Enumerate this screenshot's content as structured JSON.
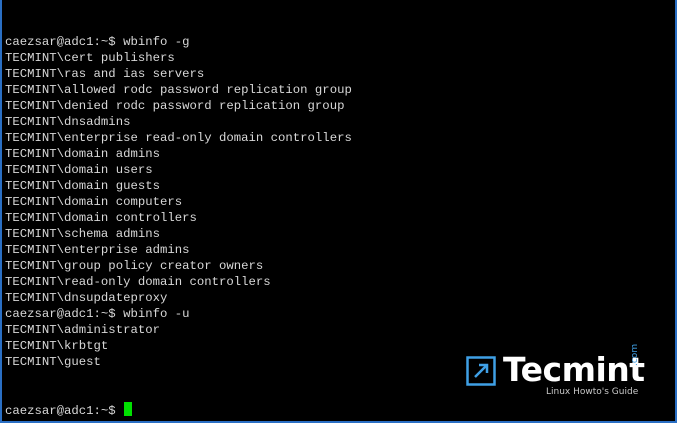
{
  "terminal": {
    "lines": [
      "caezsar@adc1:~$ wbinfo -g",
      "TECMINT\\cert publishers",
      "TECMINT\\ras and ias servers",
      "TECMINT\\allowed rodc password replication group",
      "TECMINT\\denied rodc password replication group",
      "TECMINT\\dnsadmins",
      "TECMINT\\enterprise read-only domain controllers",
      "TECMINT\\domain admins",
      "TECMINT\\domain users",
      "TECMINT\\domain guests",
      "TECMINT\\domain computers",
      "TECMINT\\domain controllers",
      "TECMINT\\schema admins",
      "TECMINT\\enterprise admins",
      "TECMINT\\group policy creator owners",
      "TECMINT\\read-only domain controllers",
      "TECMINT\\dnsupdateproxy",
      "caezsar@adc1:~$ wbinfo -u",
      "TECMINT\\administrator",
      "TECMINT\\krbtgt",
      "TECMINT\\guest"
    ],
    "prompt": "caezsar@adc1:~$ ",
    "colors": {
      "background": "#000000",
      "text": "#d8d8d8",
      "cursor": "#00e000",
      "border": "#2a6fc4"
    }
  },
  "watermark": {
    "brand": "Tecmint",
    "tld": ".com",
    "tagline": "Linux Howto's Guide",
    "icon": "tecmint-logo-icon",
    "colors": {
      "icon": "#3fa0e6",
      "text": "#ffffff",
      "tagline": "#c8c8c8"
    }
  }
}
